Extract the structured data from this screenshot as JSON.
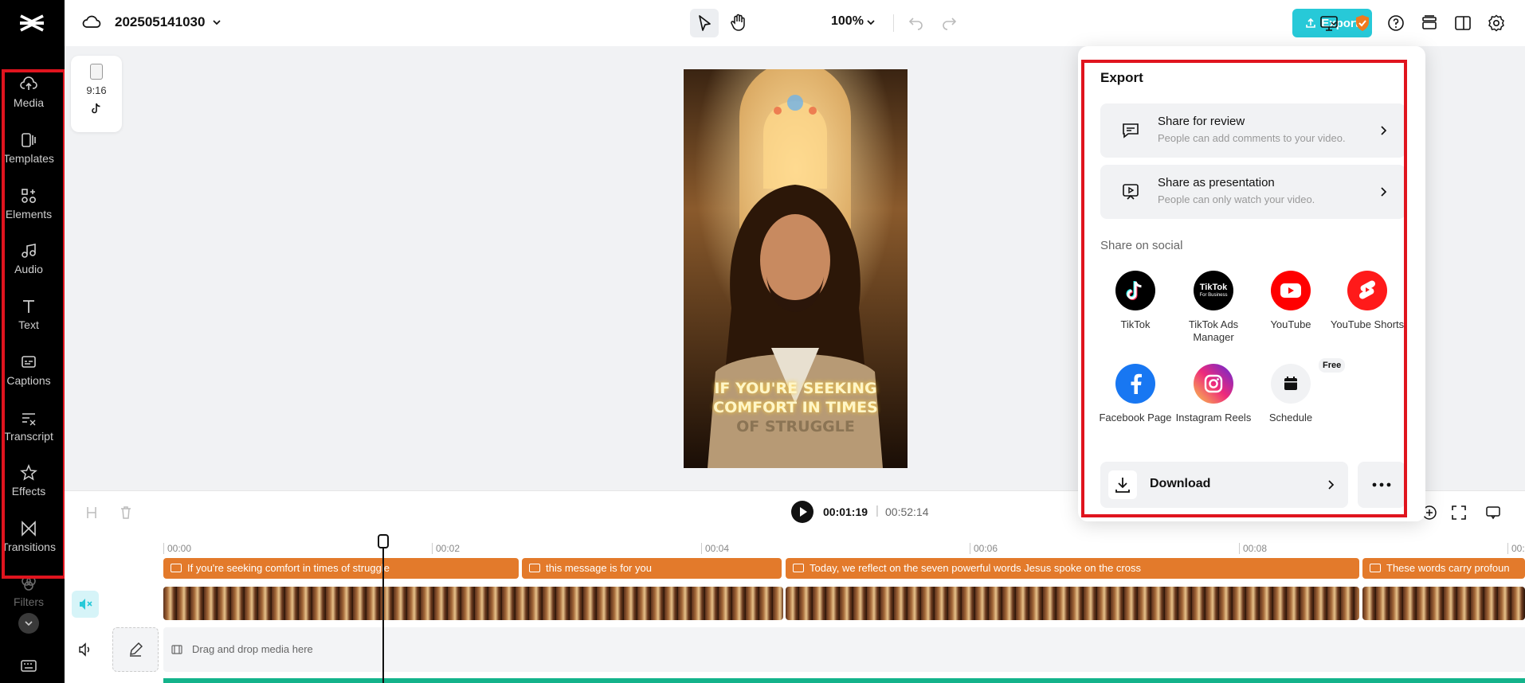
{
  "sidebar": {
    "items": [
      {
        "label": "Media",
        "icon": "cloud-upload-icon"
      },
      {
        "label": "Templates",
        "icon": "templates-icon"
      },
      {
        "label": "Elements",
        "icon": "elements-icon"
      },
      {
        "label": "Audio",
        "icon": "music-note-icon"
      },
      {
        "label": "Text",
        "icon": "text-t-icon"
      },
      {
        "label": "Captions",
        "icon": "captions-icon"
      },
      {
        "label": "Transcript",
        "icon": "transcript-icon"
      },
      {
        "label": "Effects",
        "icon": "effects-star-icon"
      },
      {
        "label": "Transitions",
        "icon": "transitions-icon"
      },
      {
        "label": "Filters",
        "icon": "filters-icon"
      }
    ]
  },
  "header": {
    "project_title": "202505141030",
    "zoom": "100%",
    "export_label": "Export",
    "accent_color": "#27c9d8"
  },
  "canvas": {
    "aspect_ratio": "9:16",
    "caption_lines": [
      "IF YOU'RE SEEKING",
      "COMFORT IN TIMES",
      "OF STRUGGLE"
    ]
  },
  "playback": {
    "current_time": "00:01:19",
    "separator": "|",
    "total_time": "00:52:14"
  },
  "timeline": {
    "ruler": [
      "00:00",
      "00:02",
      "00:04",
      "00:06",
      "00:08",
      "00:"
    ],
    "caption_clips": [
      "If you're seeking comfort in times of struggle",
      "this message is for you",
      "Today, we reflect on the seven powerful words Jesus spoke on the cross",
      "These words carry profoun"
    ],
    "drop_zone_text": "Drag and drop media here",
    "caption_color": "#e37a2b",
    "audio_color": "#14b38b"
  },
  "export_panel": {
    "title": "Export",
    "share_review": {
      "title": "Share for review",
      "subtitle": "People can add comments to your video."
    },
    "share_presentation": {
      "title": "Share as presentation",
      "subtitle": "People can only watch your video."
    },
    "social_heading": "Share on social",
    "social": [
      {
        "label": "TikTok"
      },
      {
        "label": "TikTok Ads Manager",
        "logo_text": "TikTok",
        "logo_sub": "For Business"
      },
      {
        "label": "YouTube"
      },
      {
        "label": "YouTube Shorts"
      },
      {
        "label": "Facebook Page"
      },
      {
        "label": "Instagram Reels"
      },
      {
        "label": "Schedule",
        "badge": "Free"
      }
    ],
    "download_label": "Download",
    "highlight_color": "#e0141e"
  }
}
